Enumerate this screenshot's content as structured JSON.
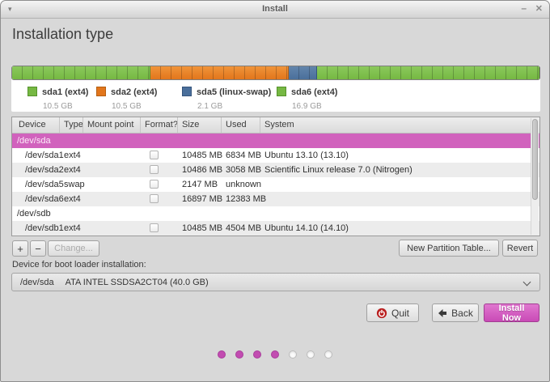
{
  "titlebar": {
    "title": "Install",
    "menu_icon": "▾",
    "minimize_icon": "–",
    "close_icon": "✕"
  },
  "page_title": "Installation type",
  "partition_bar": {
    "segments": [
      {
        "label": "sda1 (ext4)",
        "size": "10.5 GB",
        "percent": 26.25,
        "color": "#76b843",
        "color_light": "#8bc95c",
        "border": "#55922c"
      },
      {
        "label": "sda2 (ext4)",
        "size": "10.5 GB",
        "percent": 26.25,
        "color": "#e2761c",
        "color_light": "#f0943a",
        "border": "#b55f12"
      },
      {
        "label": "sda5 (linux-swap)",
        "size": "2.1 GB",
        "percent": 5.25,
        "color": "#4a6f9b",
        "color_light": "#6285ac",
        "border": "#35557d"
      },
      {
        "label": "sda6 (ext4)",
        "size": "16.9 GB",
        "percent": 42.25,
        "color": "#76b843",
        "color_light": "#8bc95c",
        "border": "#55922c"
      }
    ]
  },
  "table": {
    "columns": [
      "Device",
      "Type",
      "Mount point",
      "Format?",
      "Size",
      "Used",
      "System"
    ],
    "rows": [
      {
        "device": "/dev/sda",
        "type": "",
        "size": "",
        "used": "",
        "system": ""
      },
      {
        "device": "/dev/sda1",
        "type": "ext4",
        "size": "10485 MB",
        "used": "6834 MB",
        "system": "Ubuntu 13.10 (13.10)"
      },
      {
        "device": "/dev/sda2",
        "type": "ext4",
        "size": "10486 MB",
        "used": "3058 MB",
        "system": "Scientific Linux release 7.0 (Nitrogen)"
      },
      {
        "device": "/dev/sda5",
        "type": "swap",
        "size": "2147 MB",
        "used": "unknown",
        "system": ""
      },
      {
        "device": "/dev/sda6",
        "type": "ext4",
        "size": "16897 MB",
        "used": "12383 MB",
        "system": ""
      },
      {
        "device": "/dev/sdb",
        "type": "",
        "size": "",
        "used": "",
        "system": ""
      },
      {
        "device": "/dev/sdb1",
        "type": "ext4",
        "size": "10485 MB",
        "used": "4504 MB",
        "system": "Ubuntu 14.10 (14.10)"
      }
    ]
  },
  "toolbar": {
    "add_label": "+",
    "remove_label": "−",
    "change_label": "Change...",
    "new_table_label": "New Partition Table...",
    "revert_label": "Revert"
  },
  "bootloader": {
    "label": "Device for boot loader installation:",
    "device": "/dev/sda",
    "description": "ATA INTEL SSDSA2CT04 (40.0 GB)"
  },
  "actions": {
    "quit_label": "Quit",
    "back_label": "Back",
    "install_label": "Install Now"
  },
  "progress": {
    "total": 7,
    "completed": 4
  },
  "colors": {
    "selection": "#d162bd",
    "install_button": "#c94ab6",
    "quit_icon_red": "#b91e1e",
    "dot_filled": "#c24cb1"
  }
}
